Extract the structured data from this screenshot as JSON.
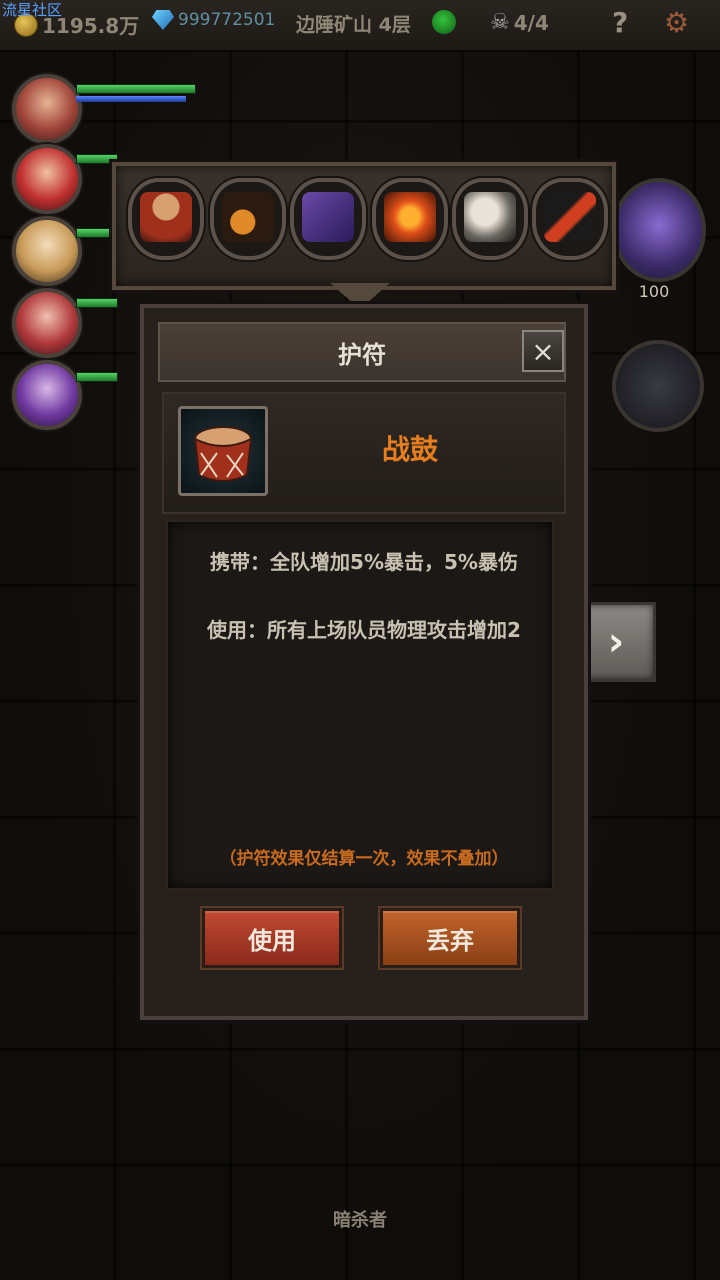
{
  "watermark": "流星社区",
  "topbar": {
    "gold": "1195.8万",
    "gems": "999772501",
    "location": "边陲矿山 4层",
    "kills": "4/4",
    "help": "?",
    "gold_icon": "coin-icon",
    "gem_icon": "diamond-icon",
    "status_icon": "smiley-icon",
    "kills_icon": "skull-icon",
    "settings_icon": "gear-icon"
  },
  "party": {
    "heroes": [
      "hero-1",
      "hero-2",
      "hero-3",
      "hero-4",
      "hero-5"
    ]
  },
  "side": {
    "companion_level": "100",
    "next_symbol": "›"
  },
  "inventory": {
    "items": [
      "war-drum",
      "pipe",
      "spellbook",
      "fire-feather",
      "griffin",
      "arrow-totem"
    ]
  },
  "dialog": {
    "title": "护符",
    "close": "×",
    "item_name": "战鼓",
    "carry_text": "携带：全队增加5%暴击，5%暴伤",
    "use_text": "使用：所有上场队员物理攻击增加2",
    "note": "（护符效果仅结算一次，效果不叠加）",
    "use_button": "使用",
    "drop_button": "丢弃"
  },
  "bottom": {
    "unit_label": "暗杀者"
  },
  "colors": {
    "accent_orange": "#e67e1e",
    "note_orange": "#c96b1e",
    "hp_green": "#3cbf4e",
    "mp_blue": "#3b62d6"
  }
}
